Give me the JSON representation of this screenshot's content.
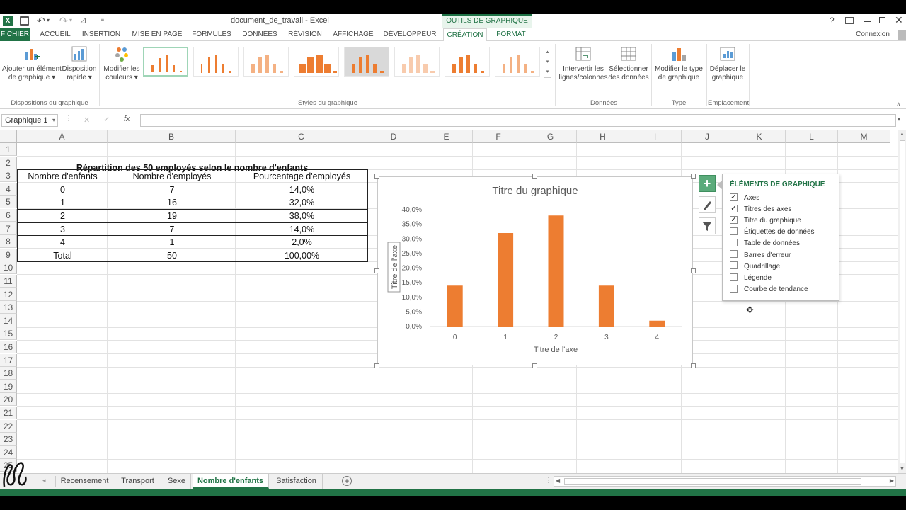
{
  "window": {
    "title": "document_de_travail - Excel",
    "contextual_group": "OUTILS DE GRAPHIQUE",
    "help": "?",
    "connexion": "Connexion"
  },
  "tabs": [
    "FICHIER",
    "ACCUEIL",
    "INSERTION",
    "MISE EN PAGE",
    "FORMULES",
    "DONNÉES",
    "RÉVISION",
    "AFFICHAGE",
    "DÉVELOPPEUR",
    "CRÉATION",
    "FORMAT"
  ],
  "ribbon": {
    "add_element": "Ajouter un élément",
    "add_element2": "de graphique ▾",
    "quick_layout": "Disposition",
    "quick_layout2": "rapide ▾",
    "change_colors": "Modifier les",
    "change_colors2": "couleurs ▾",
    "group_layouts": "Dispositions du graphique",
    "group_styles": "Styles du graphique",
    "switch_rowcol": "Intervertir les",
    "switch_rowcol2": "lignes/colonnes",
    "select_data": "Sélectionner",
    "select_data2": "des données",
    "group_data": "Données",
    "change_type": "Modifier le type",
    "change_type2": "de graphique",
    "group_type": "Type",
    "move_chart": "Déplacer le",
    "move_chart2": "graphique",
    "group_location": "Emplacement"
  },
  "formula_bar": {
    "name_box": "Graphique 1",
    "fx": "fx",
    "value": ""
  },
  "columns": [
    "A",
    "B",
    "C",
    "D",
    "E",
    "F",
    "G",
    "H",
    "I",
    "J",
    "K",
    "L",
    "M"
  ],
  "rows": [
    "1",
    "2",
    "3",
    "4",
    "5",
    "6",
    "7",
    "8",
    "9",
    "10",
    "11",
    "12",
    "13",
    "14",
    "15",
    "16",
    "17",
    "18",
    "19",
    "20",
    "21",
    "22",
    "23",
    "24",
    "25"
  ],
  "table": {
    "title": "Répartition des 50 employés selon le nombre d'enfants",
    "headers": [
      "Nombre d'enfants",
      "Nombre d'employés",
      "Pourcentage d'employés"
    ],
    "rows": [
      [
        "0",
        "7",
        "14,0%"
      ],
      [
        "1",
        "16",
        "32,0%"
      ],
      [
        "2",
        "19",
        "38,0%"
      ],
      [
        "3",
        "7",
        "14,0%"
      ],
      [
        "4",
        "1",
        "2,0%"
      ],
      [
        "Total",
        "50",
        "100,00%"
      ]
    ]
  },
  "chart_data": {
    "type": "bar",
    "title": "Titre du graphique",
    "xlabel": "Titre de l'axe",
    "ylabel": "Titre de l'axe",
    "categories": [
      "0",
      "1",
      "2",
      "3",
      "4"
    ],
    "values": [
      14.0,
      32.0,
      38.0,
      14.0,
      2.0
    ],
    "ylim": [
      0,
      40
    ],
    "yticks": [
      "0,0%",
      "5,0%",
      "10,0%",
      "15,0%",
      "20,0%",
      "25,0%",
      "30,0%",
      "35,0%",
      "40,0%"
    ],
    "color": "#ED7D31",
    "grid": false,
    "legend": "none"
  },
  "chart_elements_panel": {
    "title": "ÉLÉMENTS DE GRAPHIQUE",
    "items": [
      {
        "label": "Axes",
        "checked": true
      },
      {
        "label": "Titres des axes",
        "checked": true
      },
      {
        "label": "Titre du graphique",
        "checked": true
      },
      {
        "label": "Étiquettes de données",
        "checked": false
      },
      {
        "label": "Table de données",
        "checked": false
      },
      {
        "label": "Barres d'erreur",
        "checked": false
      },
      {
        "label": "Quadrillage",
        "checked": false
      },
      {
        "label": "Légende",
        "checked": false
      },
      {
        "label": "Courbe de tendance",
        "checked": false
      }
    ]
  },
  "sheets": {
    "tabs": [
      "Recensement",
      "Transport",
      "Sexe",
      "Nombre d'enfants",
      "Satisfaction"
    ],
    "active": "Nombre d'enfants"
  },
  "colors": {
    "excel_green": "#217346",
    "bar_orange": "#ED7D31"
  }
}
